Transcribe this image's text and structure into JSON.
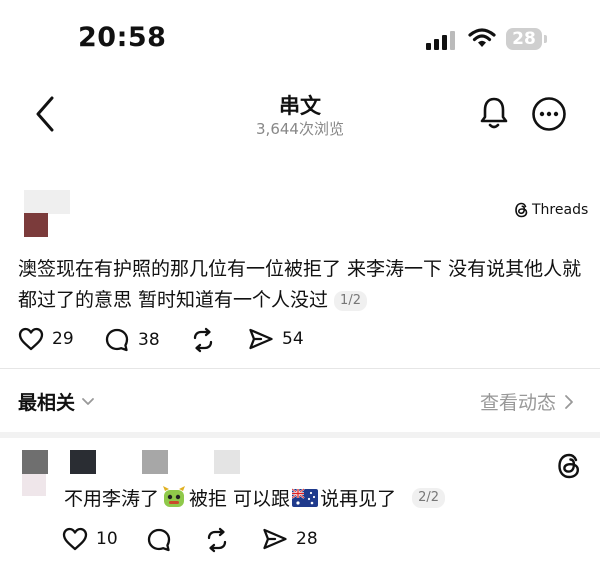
{
  "status_bar": {
    "time": "20:58",
    "battery": "28"
  },
  "nav": {
    "title": "串文",
    "views": "3,644次浏览"
  },
  "post": {
    "source": "Threads",
    "text": "澳签现在有护照的那几位有一位被拒了 来李涛一下 没有说其他人就都过了的意思 暂时知道有一个人没过",
    "page": "1/2",
    "likes": "29",
    "comments": "38",
    "reposts": "",
    "shares": "54"
  },
  "sort": {
    "label": "最相关",
    "activity": "查看动态"
  },
  "reply": {
    "text_before": "不用李涛了",
    "text_middle": "被拒 可以跟",
    "text_after": "说再见了",
    "page": "2/2",
    "likes": "10",
    "comments": "",
    "reposts": "",
    "shares": "28"
  },
  "colors": {
    "accent_red": "#7b3b3b",
    "muted_text": "#888888"
  }
}
